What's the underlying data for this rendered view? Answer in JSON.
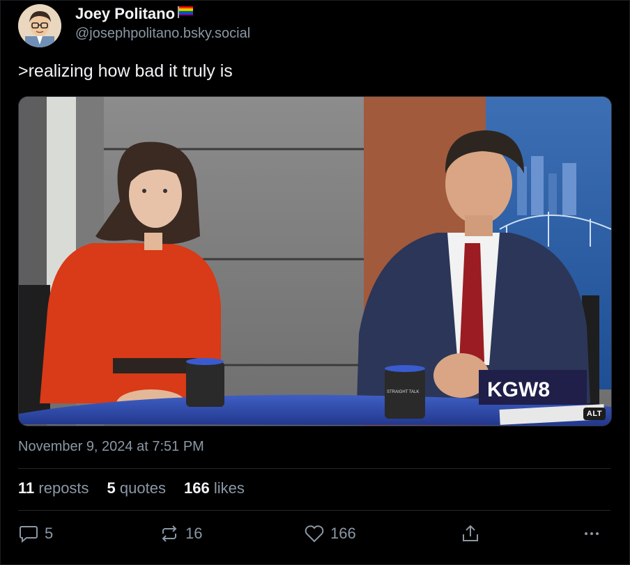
{
  "author": {
    "display_name": "Joey Politano",
    "handle": "@josephpolitano.bsky.social",
    "flag_icon": "rainbow-flag-icon"
  },
  "post": {
    "text": ">realizing how bad it truly is",
    "media_alt_label": "ALT",
    "media_overlay_logo": "KGW8",
    "mug_text": "STRAIGHT TALK",
    "timestamp": "November 9, 2024 at 7:51 PM"
  },
  "stats": {
    "reposts_count": "11",
    "reposts_label": "reposts",
    "quotes_count": "5",
    "quotes_label": "quotes",
    "likes_count": "166",
    "likes_label": "likes"
  },
  "actions": {
    "reply_count": "5",
    "repost_count": "16",
    "like_count": "166"
  },
  "colors": {
    "background": "#000000",
    "muted_text": "#8b98a5",
    "primary_text": "#f1f3f5"
  }
}
